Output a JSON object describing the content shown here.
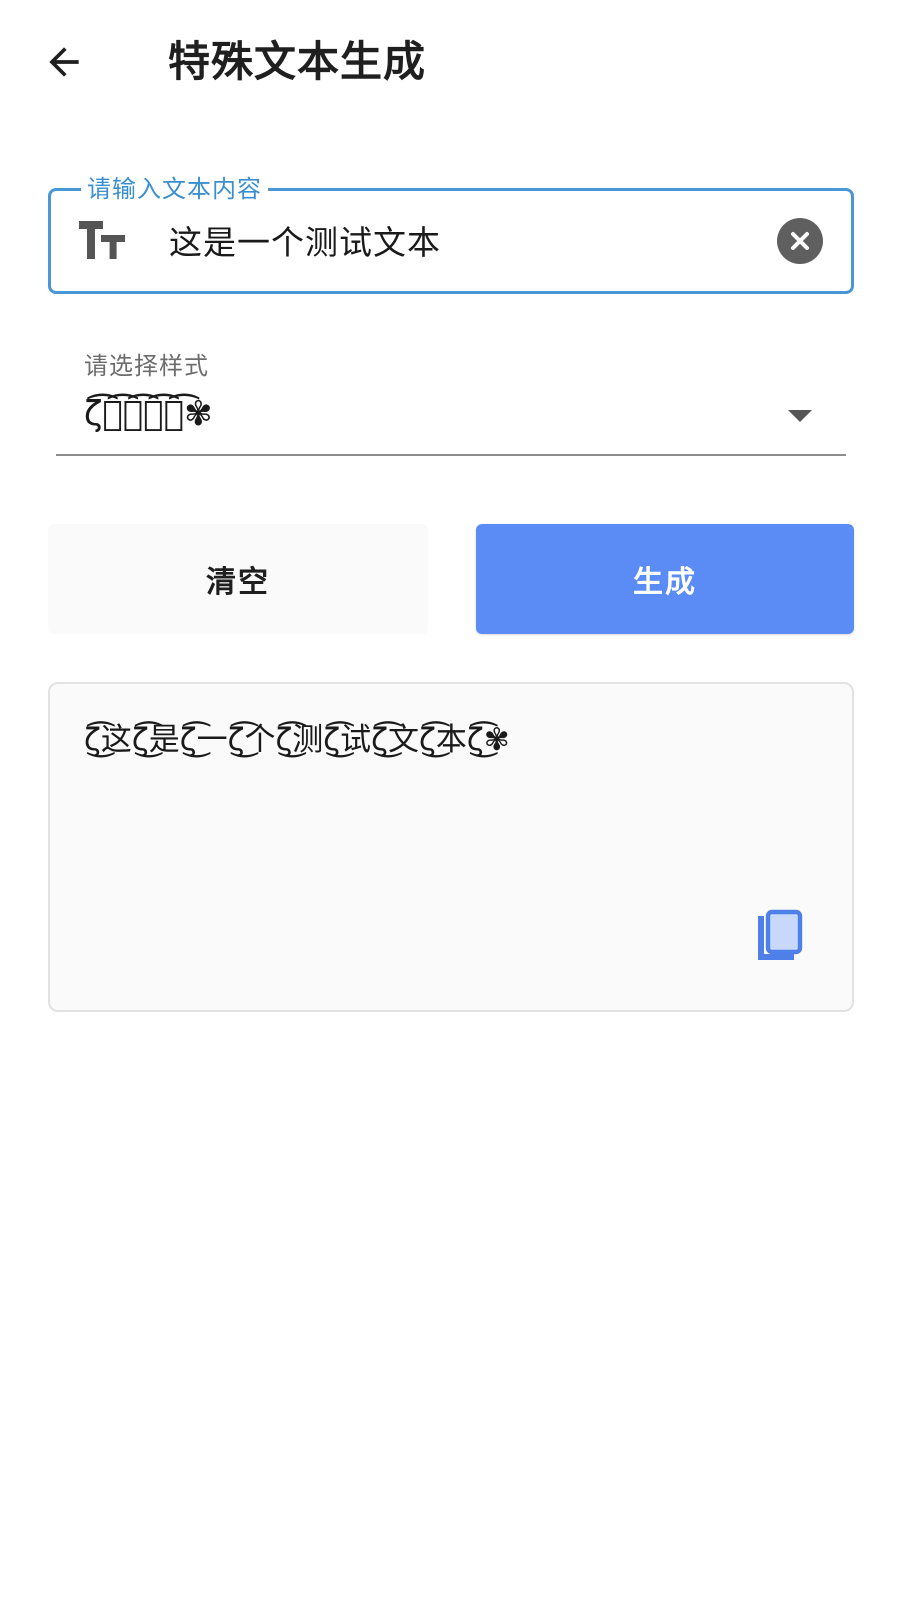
{
  "header": {
    "back_icon": "arrow-left-icon",
    "title": "特殊文本生成"
  },
  "input": {
    "label": "请输入文本内容",
    "value": "这是一个测试文本",
    "leading_icon": "text-fields-icon",
    "trailing_icon": "clear-circle-icon",
    "accent_color": "#4a97d8"
  },
  "style_select": {
    "label": "请选择样式",
    "selected_value": "ζ͡测͡试͡测͡试͡✾",
    "icon": "dropdown-arrow-icon"
  },
  "actions": {
    "clear_label": "清空",
    "generate_label": "生成",
    "generate_color": "#5b8bf5"
  },
  "output": {
    "text": "ζ͜͡这ζ͜͡是ζ͜͡一ζ͜͡个ζ͜͡测ζ͜͡试ζ͜͡文ζ͜͡本ζ͜͡✾",
    "copy_icon": "copy-icon",
    "icon_color": "#4f7fe8"
  }
}
